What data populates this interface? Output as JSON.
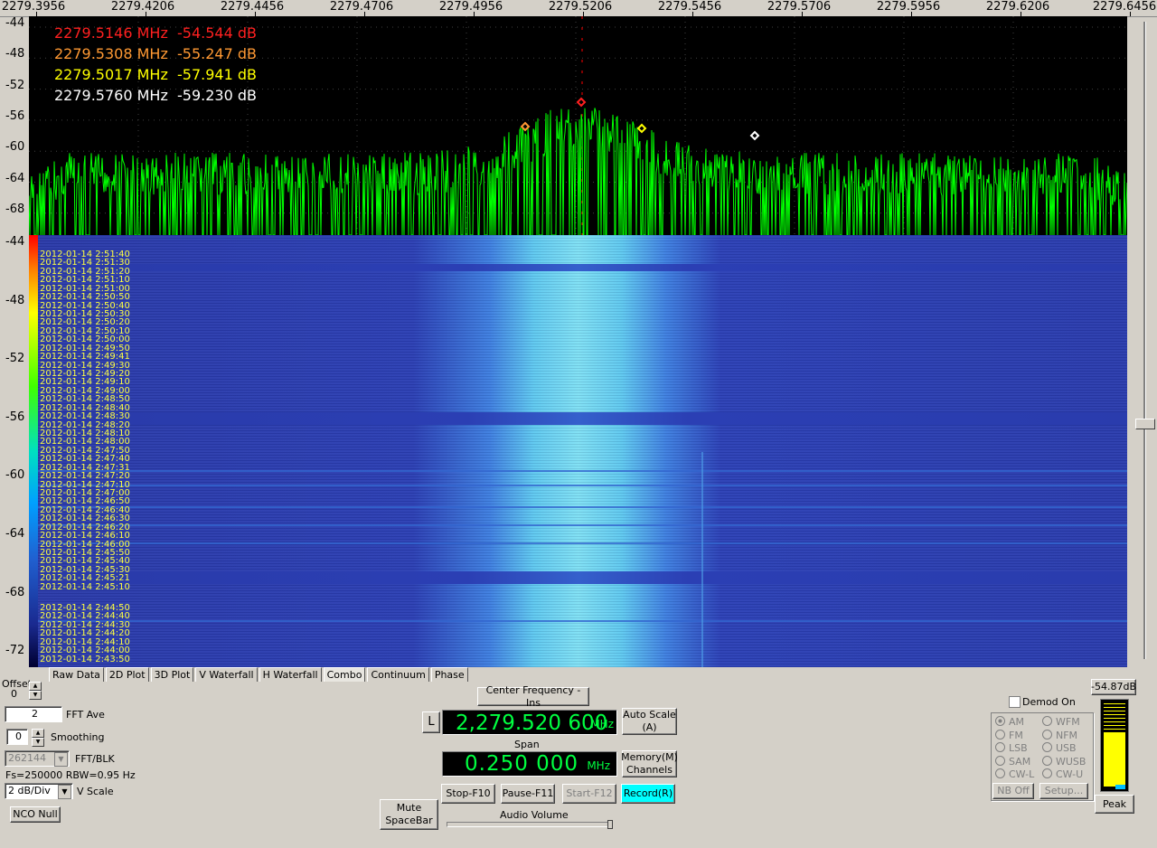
{
  "freq_axis": {
    "ticks": [
      "2279.3956",
      "2279.4206",
      "2279.4456",
      "2279.4706",
      "2279.4956",
      "2279.5206",
      "2279.5456",
      "2279.5706",
      "2279.5956",
      "2279.6206",
      "2279.6456"
    ]
  },
  "spectrum": {
    "y_labels": [
      "-44",
      "-48",
      "-52",
      "-56",
      "-60",
      "-64",
      "-68"
    ],
    "markers": [
      {
        "text": "2279.5146 MHz  -54.544 dB",
        "color": "#ff2020"
      },
      {
        "text": "2279.5308 MHz  -55.247 dB",
        "color": "#ff9933"
      },
      {
        "text": "2279.5017 MHz  -57.941 dB",
        "color": "#ffff00"
      },
      {
        "text": "2279.5760 MHz  -59.230 dB",
        "color": "#ffffff"
      }
    ]
  },
  "waterfall": {
    "y_labels": [
      "-44",
      "-48",
      "-52",
      "-56",
      "-60",
      "-64",
      "-68",
      "-72"
    ],
    "timestamps": [
      "2012-01-14 2:51:40",
      "2012-01-14 2:51:30",
      "2012-01-14 2:51:20",
      "2012-01-14 2:51:10",
      "2012-01-14 2:51:00",
      "2012-01-14 2:50:50",
      "2012-01-14 2:50:40",
      "2012-01-14 2:50:30",
      "2012-01-14 2:50:20",
      "2012-01-14 2:50:10",
      "2012-01-14 2:50:00",
      "2012-01-14 2:49:50",
      "2012-01-14 2:49:41",
      "2012-01-14 2:49:30",
      "2012-01-14 2:49:20",
      "2012-01-14 2:49:10",
      "2012-01-14 2:49:00",
      "2012-01-14 2:48:50",
      "2012-01-14 2:48:40",
      "2012-01-14 2:48:30",
      "2012-01-14 2:48:20",
      "2012-01-14 2:48:10",
      "2012-01-14 2:48:00",
      "2012-01-14 2:47:50",
      "2012-01-14 2:47:40",
      "2012-01-14 2:47:31",
      "2012-01-14 2:47:20",
      "2012-01-14 2:47:10",
      "2012-01-14 2:47:00",
      "2012-01-14 2:46:50",
      "2012-01-14 2:46:40",
      "2012-01-14 2:46:30",
      "2012-01-14 2:46:20",
      "2012-01-14 2:46:10",
      "2012-01-14 2:46:00",
      "2012-01-14 2:45:50",
      "2012-01-14 2:45:40",
      "2012-01-14 2:45:30",
      "2012-01-14 2:45:21",
      "2012-01-14 2:45:10"
    ],
    "timestamps_lower": [
      "2012-01-14 2:44:50",
      "2012-01-14 2:44:40",
      "2012-01-14 2:44:30",
      "2012-01-14 2:44:20",
      "2012-01-14 2:44:10",
      "2012-01-14 2:44:00",
      "2012-01-14 2:43:50"
    ]
  },
  "tabs": [
    "Raw Data",
    "2D Plot",
    "3D Plot",
    "V Waterfall",
    "H Waterfall",
    "Combo",
    "Continuum",
    "Phase"
  ],
  "active_tab": "Combo",
  "controls": {
    "offset_label": "Offset",
    "offset_value": "0",
    "fft_ave_value": "2",
    "fft_ave_label": "FFT Ave",
    "smoothing_value": "0",
    "smoothing_label": "Smoothing",
    "fft_blk_value": "262144",
    "fft_blk_label": "FFT/BLK",
    "fs_rbw": "Fs=250000 RBW=0.95 Hz",
    "vscale_value": "2 dB/Div",
    "vscale_label": "V Scale",
    "nco_null": "NCO Null",
    "center_freq_button": "Center Frequency - Ins",
    "l_button": "L",
    "center_freq": "2,279.520 600",
    "mhz": "MHz",
    "auto_scale": "Auto Scale\n(A)",
    "span_label": "Span",
    "span_value": "0.250 000",
    "memory_channels": "Memory(M)\nChannels",
    "stop": "Stop-F10",
    "pause": "Pause-F11",
    "start": "Start-F12",
    "record": "Record(R)",
    "mute": "Mute\nSpaceBar",
    "audio_volume": "Audio Volume",
    "peak_db": "-54.87dB",
    "demod_on": "Demod On",
    "peak_button": "Peak",
    "nb_off": "NB Off",
    "setup": "Setup...",
    "modes": [
      "AM",
      "WFM",
      "FM",
      "NFM",
      "LSB",
      "USB",
      "SAM",
      "WUSB",
      "CW-L",
      "CW-U"
    ]
  },
  "colors": {
    "spectrum_trace": "#00ff00",
    "record_button": "#00ffff",
    "timestamp_text": "#ffff40"
  }
}
